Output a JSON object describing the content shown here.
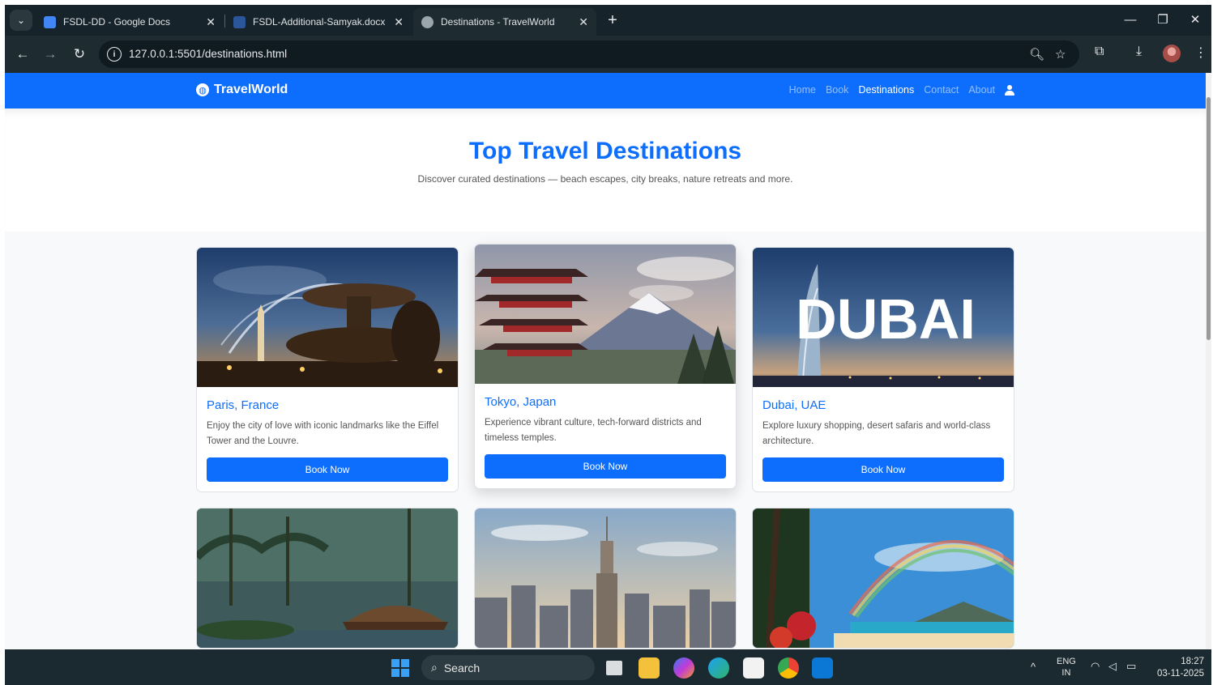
{
  "browser": {
    "tabs": [
      {
        "title": "FSDL-DD - Google Docs",
        "icon": "google-docs-icon",
        "active": false
      },
      {
        "title": "FSDL-Additional-Samyak.docx",
        "icon": "word-icon",
        "active": false
      },
      {
        "title": "Destinations - TravelWorld",
        "icon": "globe-icon",
        "active": true
      }
    ],
    "url": "127.0.0.1:5501/destinations.html"
  },
  "site": {
    "brand": "TravelWorld",
    "nav": [
      "Home",
      "Book",
      "Destinations",
      "Contact",
      "About"
    ],
    "active_nav": "Destinations"
  },
  "hero": {
    "title": "Top Travel Destinations",
    "subtitle": "Discover curated destinations — beach escapes, city breaks, nature retreats and more."
  },
  "destinations": [
    {
      "title": "Paris, France",
      "description": "Enjoy the city of love with iconic landmarks like the Eiffel Tower and the Louvre.",
      "button": "Book Now"
    },
    {
      "title": "Tokyo, Japan",
      "description": "Experience vibrant culture, tech-forward districts and timeless temples.",
      "button": "Book Now"
    },
    {
      "title": "Dubai, UAE",
      "description": "Explore luxury shopping, desert safaris and world-class architecture.",
      "button": "Book Now",
      "image_text": "DUBAI"
    }
  ],
  "taskbar": {
    "search": "Search",
    "lang_top": "ENG",
    "lang_bottom": "IN",
    "time": "18:27",
    "date": "03-11-2025"
  },
  "colors": {
    "primary": "#0d6efd",
    "chrome_bg": "#1e2b30",
    "taskbar_bg": "#1b2a30",
    "section_bg": "#f8f9fa"
  }
}
